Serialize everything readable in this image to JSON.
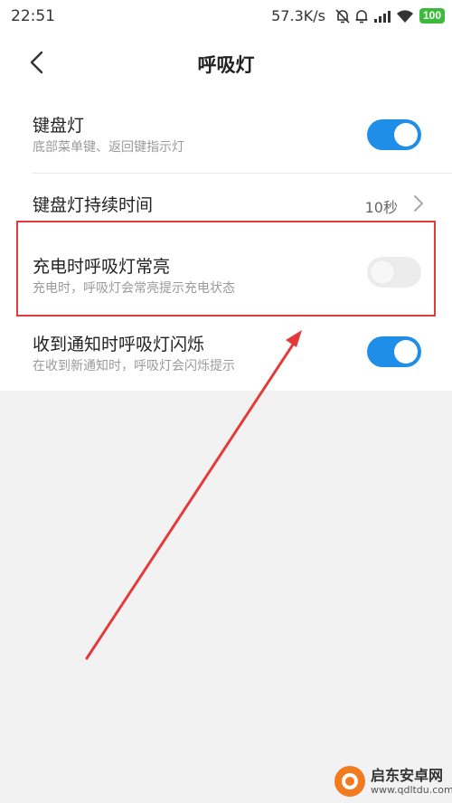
{
  "status_bar": {
    "time": "22:51",
    "net_speed": "57.3K/s",
    "battery": "100",
    "icons": [
      "mute-icon",
      "alarm-icon",
      "signal-icon",
      "wifi-icon",
      "battery-icon"
    ]
  },
  "header": {
    "title": "呼吸灯",
    "back_icon": "chevron-left-icon"
  },
  "settings": {
    "keyboard_light": {
      "title": "键盘灯",
      "subtitle": "底部菜单键、返回键指示灯",
      "enabled": true
    },
    "keyboard_duration": {
      "title": "键盘灯持续时间",
      "value": "10秒"
    },
    "charging_light": {
      "title": "充电时呼吸灯常亮",
      "subtitle": "充电时，呼吸灯会常亮提示充电状态",
      "enabled": false
    },
    "notification_light": {
      "title": "收到通知时呼吸灯闪烁",
      "subtitle": "在收到新通知时，呼吸灯会闪烁提示",
      "enabled": true
    }
  },
  "watermark": {
    "name": "启东安卓网",
    "url": "www.qdltdu.com"
  },
  "colors": {
    "accent": "#1f8ee8",
    "annotation": "#e53a3a",
    "toggle_off": "#ececec"
  }
}
